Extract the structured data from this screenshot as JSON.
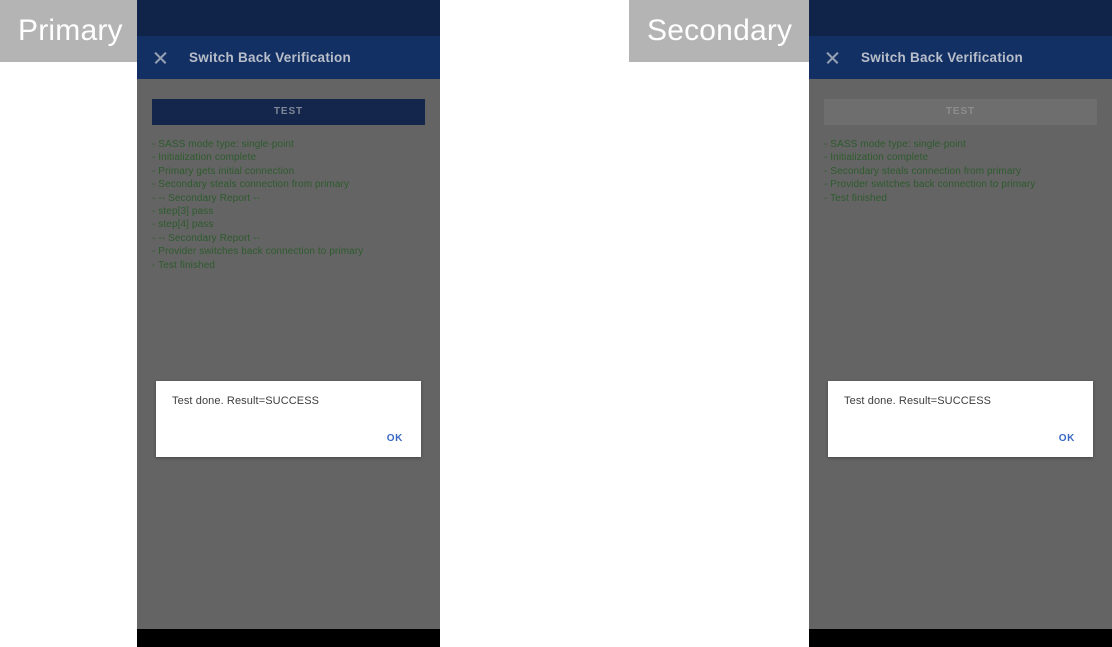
{
  "captions": {
    "primary": "Primary",
    "secondary": "Secondary"
  },
  "colors": {
    "status_bar": "#10244a",
    "app_bar": "#133064",
    "body": "#646464",
    "log_text": "#2e5b2e",
    "button_enabled_bg": "#15264c",
    "button_disabled_bg": "#6e6e6e",
    "dialog_bg": "#ffffff",
    "ok_text": "#3b68c4",
    "caption_bg": "#b4b4b4",
    "nav_bar": "#000000"
  },
  "primary": {
    "app_bar": {
      "close_icon": "close-icon",
      "title": "Switch Back Verification"
    },
    "test_button": {
      "label": "TEST",
      "enabled": true
    },
    "log_lines": [
      "- SASS mode type: single-point",
      "- Initialization complete",
      "- Primary gets initial connection",
      "- Secondary steals connection from primary",
      "- -- Secondary Report --",
      "- step[3] pass",
      "- step[4] pass",
      "- -- Secondary Report --",
      "- Provider switches back connection to primary",
      "- Test finished"
    ],
    "dialog": {
      "message": "Test done. Result=SUCCESS",
      "ok_label": "OK"
    }
  },
  "secondary": {
    "app_bar": {
      "close_icon": "close-icon",
      "title": "Switch Back Verification"
    },
    "test_button": {
      "label": "TEST",
      "enabled": false
    },
    "log_lines": [
      "- SASS mode type: single-point",
      "- Initialization complete",
      "- Secondary steals connection from primary",
      "- Provider switches back connection to primary",
      "- Test finished"
    ],
    "dialog": {
      "message": "Test done. Result=SUCCESS",
      "ok_label": "OK"
    }
  }
}
